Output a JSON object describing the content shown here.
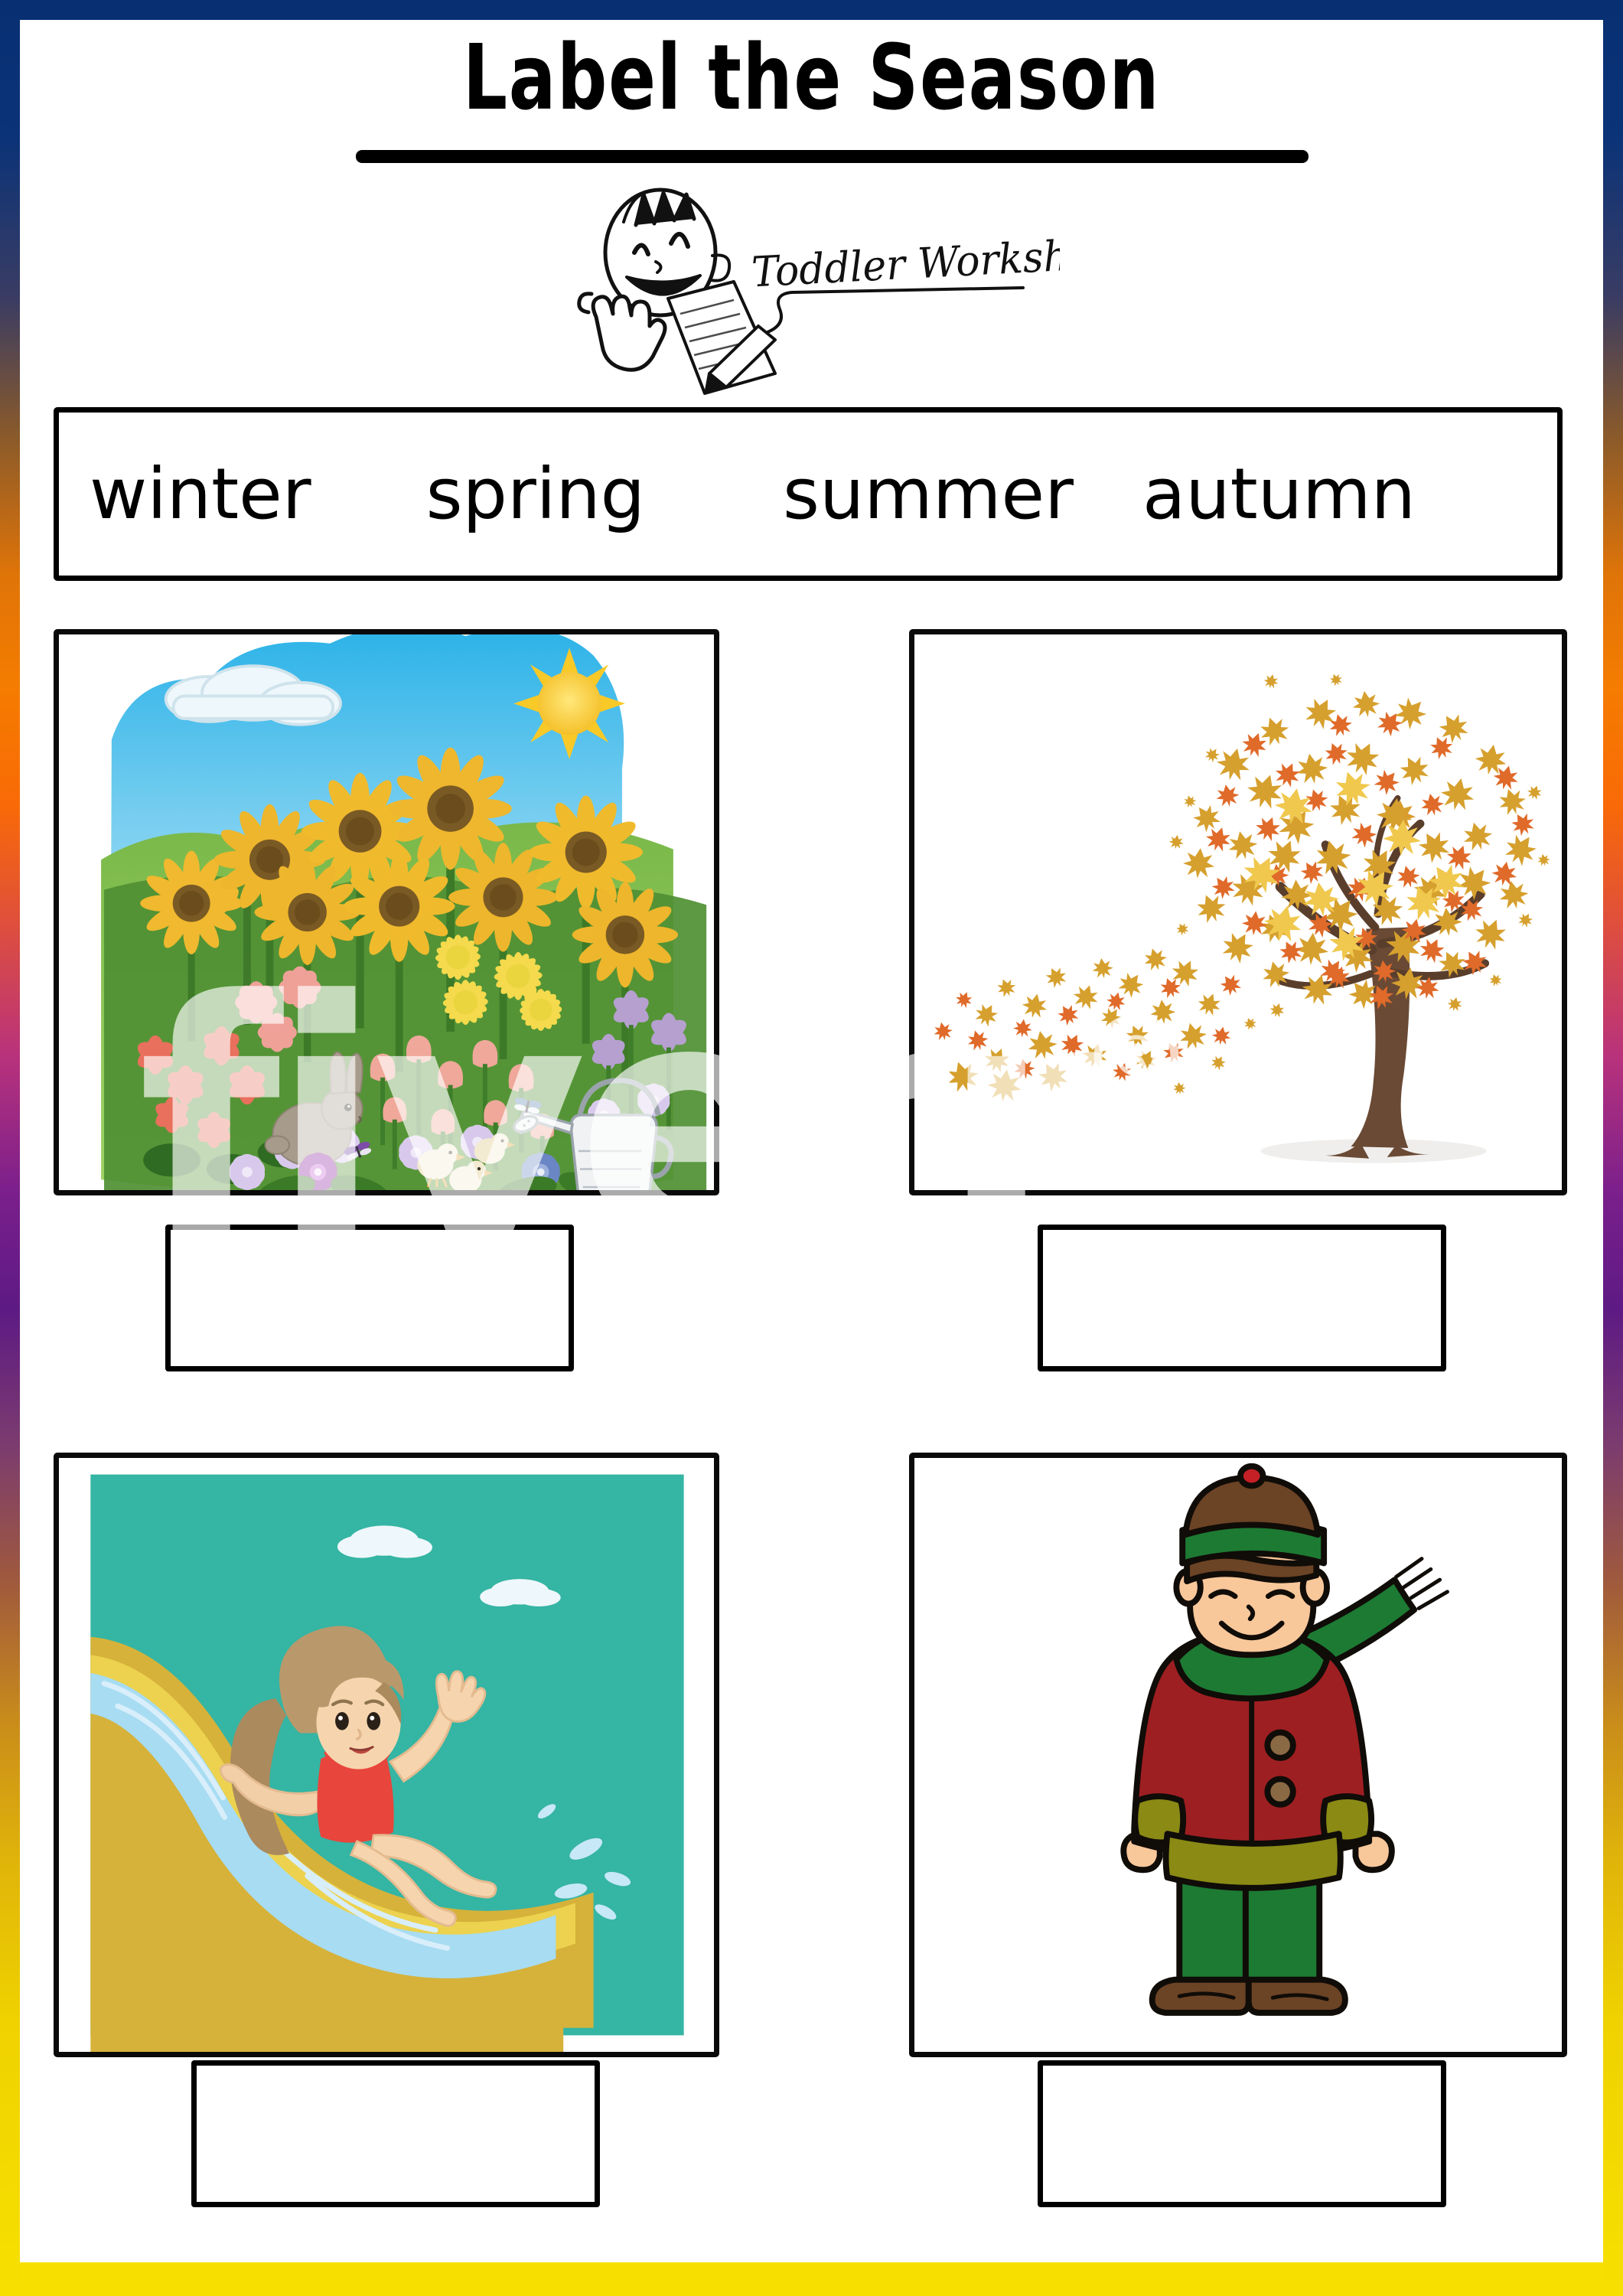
{
  "document": {
    "title": "Label the Season",
    "publisher": "Toddler Worksheets",
    "watermark": "fiverr",
    "watermark_mark": "®"
  },
  "word_bank": {
    "words": [
      "winter",
      "spring",
      "summer",
      "autumn"
    ]
  },
  "items": [
    {
      "id": "item-spring",
      "picture_name": "spring-garden-illustration",
      "alt": "Garden with sunflowers, tulips, rabbit, chicks, watering can, sun and cloud",
      "answer_value": ""
    },
    {
      "id": "item-autumn",
      "picture_name": "autumn-tree-illustration",
      "alt": "Tree with orange and yellow maple leaves blowing in the wind",
      "answer_value": ""
    },
    {
      "id": "item-summer",
      "picture_name": "summer-waterslide-illustration",
      "alt": "Girl in red swimsuit riding down a water slide",
      "answer_value": ""
    },
    {
      "id": "item-winter",
      "picture_name": "winter-boy-illustration",
      "alt": "Boy in winter hat, green scarf, red coat, green trousers and brown boots",
      "answer_value": ""
    }
  ],
  "colors": {
    "border_top": "#072f72",
    "border_bottom": "#f7e000",
    "border_orange": "#f57c00",
    "border_purple": "#7a1f8c",
    "ink": "#000000",
    "sky_blue": "#38b6e8",
    "grass_green": "#5a9e34",
    "sun_yellow": "#f9d02b",
    "autumn_orange": "#e8722a",
    "autumn_gold": "#dba32a",
    "trunk_brown": "#6b4a33",
    "pool_teal": "#35b3a3",
    "slide_yellow": "#e8c53c",
    "water_blue": "#a7dcf2",
    "swimsuit_red": "#e8453c",
    "coat_red": "#9e1f22",
    "coat_trim_olive": "#8a8a15",
    "scarf_green": "#1d7a33",
    "pants_green": "#1d7a33",
    "boot_brown": "#6b4325",
    "skin": "#f8c79a"
  }
}
